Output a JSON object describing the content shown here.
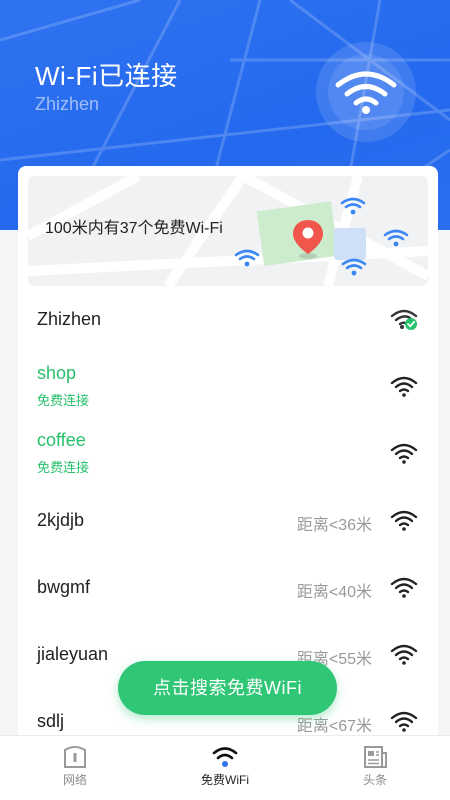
{
  "header": {
    "title": "Wi-Fi已连接",
    "ssid": "Zhizhen",
    "badge_icon": "wifi-icon",
    "bg_color": "#2469ee"
  },
  "map_card": {
    "summary": "100米内有37个免费Wi-Fi",
    "pin_color": "#f0564b",
    "icons": [
      "wifi-icon",
      "wifi-icon",
      "wifi-icon",
      "wifi-icon",
      "location-pin-icon"
    ]
  },
  "networks": [
    {
      "name": "Zhizhen",
      "status": "connected",
      "icon": "wifi-connected-icon"
    },
    {
      "name": "shop",
      "sub": "免费连接",
      "icon": "wifi-icon"
    },
    {
      "name": "coffee",
      "sub": "免费连接",
      "icon": "wifi-icon"
    },
    {
      "name": "2kjdjb",
      "distance": "距离<36米",
      "icon": "wifi-icon"
    },
    {
      "name": "bwgmf",
      "distance": "距离<40米",
      "icon": "wifi-icon"
    },
    {
      "name": "jialeyuan",
      "distance": "距离<55米",
      "icon": "wifi-icon"
    },
    {
      "name": "sdlj",
      "distance": "距离<67米",
      "icon": "wifi-icon"
    }
  ],
  "search_button": {
    "label": "点击搜索免费WiFi",
    "color": "#2fc676"
  },
  "tabbar": {
    "tabs": [
      {
        "label": "网络",
        "icon": "network-icon",
        "active": false
      },
      {
        "label": "免费WiFi",
        "icon": "wifi-icon",
        "active": true
      },
      {
        "label": "头条",
        "icon": "news-icon",
        "active": false
      }
    ]
  },
  "colors": {
    "accent_green": "#27c06b",
    "primary_blue": "#2f73f0"
  }
}
